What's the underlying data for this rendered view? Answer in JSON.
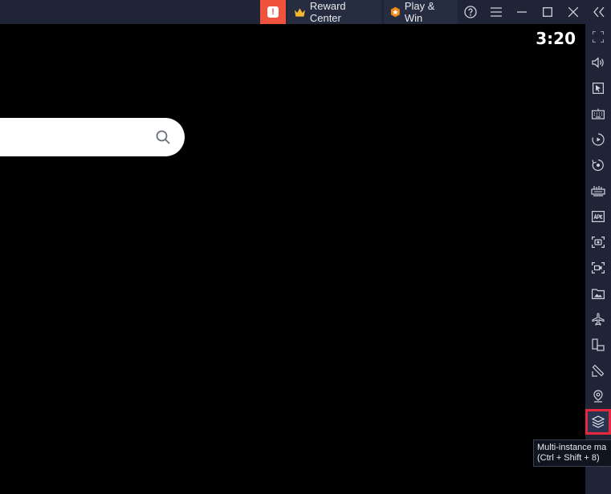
{
  "topbar": {
    "alert_icon": "alert-icon",
    "alert_glyph": "!",
    "reward_center_label": "Reward Center",
    "play_win_label": "Play & Win",
    "icons": [
      "help-icon",
      "menu-icon",
      "minimize-icon",
      "maximize-icon",
      "close-icon",
      "collapse-sidebar-icon"
    ]
  },
  "main": {
    "clock": "3:20"
  },
  "sidebar": {
    "items": [
      "fullscreen-icon",
      "volume-icon",
      "pointer-icon",
      "keyboard-icon",
      "macro-record-icon",
      "rotate-icon",
      "performance-icon",
      "install-apk-icon",
      "screenshot-icon",
      "screen-record-icon",
      "media-folder-icon",
      "airplane-mode-icon",
      "multi-screen-icon",
      "eco-mode-icon",
      "location-icon",
      "multi-instance-icon"
    ],
    "active_item": "multi-instance-icon"
  },
  "tooltip": {
    "line1": "Multi-instance ma",
    "line2": "(Ctrl + Shift + 8)"
  },
  "colors": {
    "chrome": "#1f2537",
    "alert": "#f0533c",
    "highlight": "#e5283c",
    "reward_crown": "#f5b82e",
    "play_badge": "#f28a1b"
  }
}
